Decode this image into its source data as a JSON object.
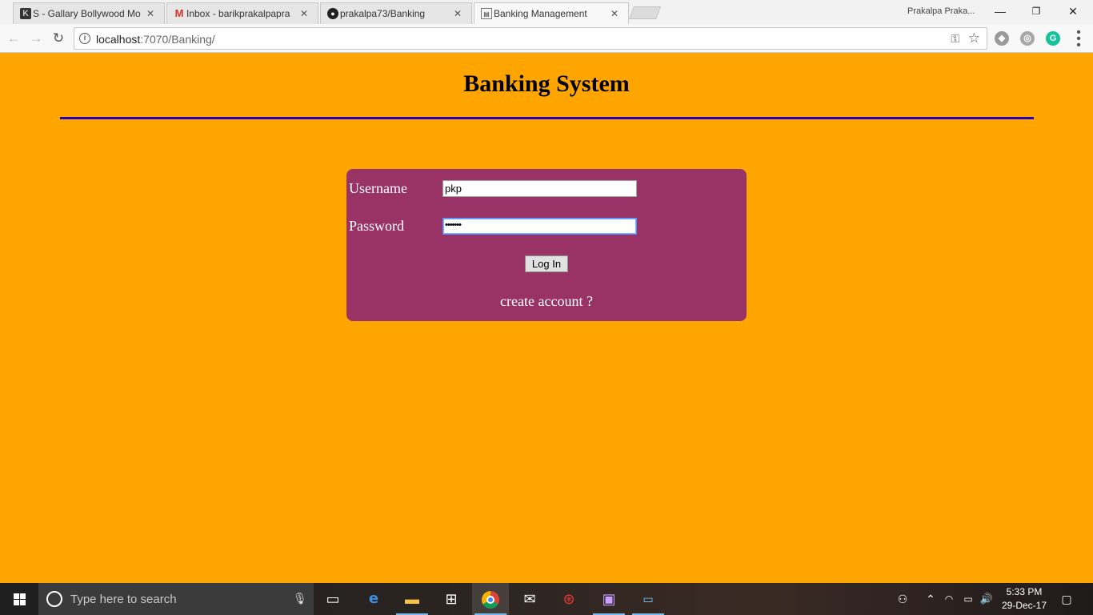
{
  "browser": {
    "tabs": [
      {
        "title": "S - Gallary Bollywood Mo",
        "icon": "k-favicon",
        "active": false
      },
      {
        "title": "Inbox - barikprakalpapra",
        "icon": "gmail-favicon",
        "active": false
      },
      {
        "title": "prakalpa73/Banking",
        "icon": "github-favicon",
        "active": false
      },
      {
        "title": "Banking Management",
        "icon": "page-favicon",
        "active": true
      }
    ],
    "profile_name": "Prakalpa Praka...",
    "url_host": "localhost",
    "url_rest": ":7070/Banking/"
  },
  "page": {
    "title": "Banking System",
    "username_label": "Username",
    "username_value": "pkp",
    "password_label": "Password",
    "password_value": "•••••••",
    "login_label": "Log In",
    "create_account": "create account ?"
  },
  "taskbar": {
    "search_placeholder": "Type here to search",
    "time": "5:33 PM",
    "date": "29-Dec-17"
  },
  "colors": {
    "page_background": "#ffa500",
    "login_box": "#993366",
    "divider": "#2a00b8"
  }
}
